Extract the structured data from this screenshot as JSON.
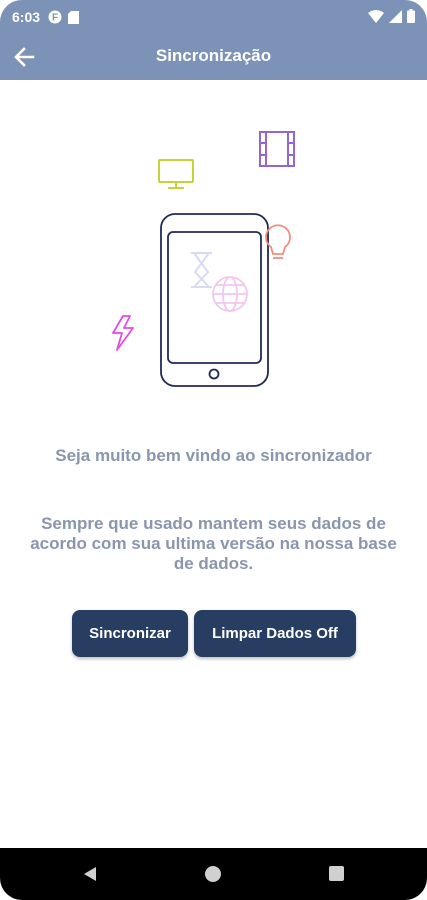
{
  "status": {
    "time": "6:03"
  },
  "appbar": {
    "title": "Sincronização"
  },
  "content": {
    "welcome": "Seja muito bem vindo ao sincronizador",
    "description": "Sempre que usado mantem seus dados de acordo com sua ultima versão na nossa base de dados."
  },
  "buttons": {
    "sync_label": "Sincronizar",
    "clear_label": "Limpar Dados Off"
  },
  "colors": {
    "appbar": "#7d92b7",
    "button": "#273d62",
    "text_muted": "#8a96ae"
  },
  "icons": [
    "back-arrow-icon",
    "monitor-icon",
    "film-icon",
    "lightbulb-icon",
    "lightning-icon",
    "hourglass-icon",
    "globe-icon",
    "phone-icon"
  ]
}
